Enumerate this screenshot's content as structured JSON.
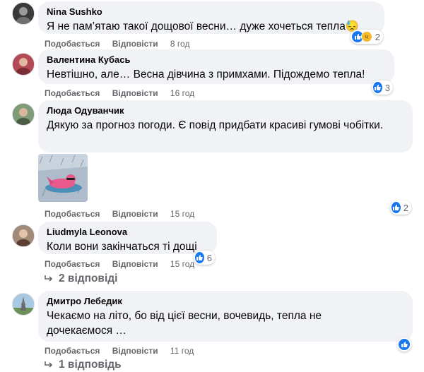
{
  "comments": [
    {
      "author": "Nina Sushko",
      "text": "Я не пам’ятаю такої дощової весни… дуже хочеться тепла😓",
      "like": "Подобається",
      "reply": "Відповісти",
      "time": "8 год",
      "reactions": "2"
    },
    {
      "author": "Валентина Кубась",
      "text": "Невтішно, але… Весна дівчина з примхами. Підождемо тепла!",
      "like": "Подобається",
      "reply": "Відповісти",
      "time": "16 год",
      "reactions": "3"
    },
    {
      "author": "Люда Одуванчик",
      "text": "Дякую за прогноз погоди. Є повід придбати красиві гумові чобітки.",
      "like": "Подобається",
      "reply": "Відповісти",
      "time": "15 год",
      "reactions": "2"
    },
    {
      "author": "Liudmyla Leonova",
      "text": "Коли вони закінчаться ті дощі",
      "like": "Подобається",
      "reply": "Відповісти",
      "time": "15 год",
      "reactions": "6",
      "replies": "2 відповіді"
    },
    {
      "author": "Дмитро Лебедик",
      "text": "Чекаємо на літо, бо від цієї весни, вочевидь, тепла не дочекаємося …",
      "like": "Подобається",
      "reply": "Відповісти",
      "time": "11 год",
      "replies": "1 відповідь"
    }
  ],
  "colors": {
    "bubble": "#f0f2f5",
    "meta": "#65676b",
    "like": "#1877f2",
    "care": "#f7b928"
  },
  "icons": [
    "like-icon",
    "care-icon",
    "reply-arrow-icon"
  ]
}
